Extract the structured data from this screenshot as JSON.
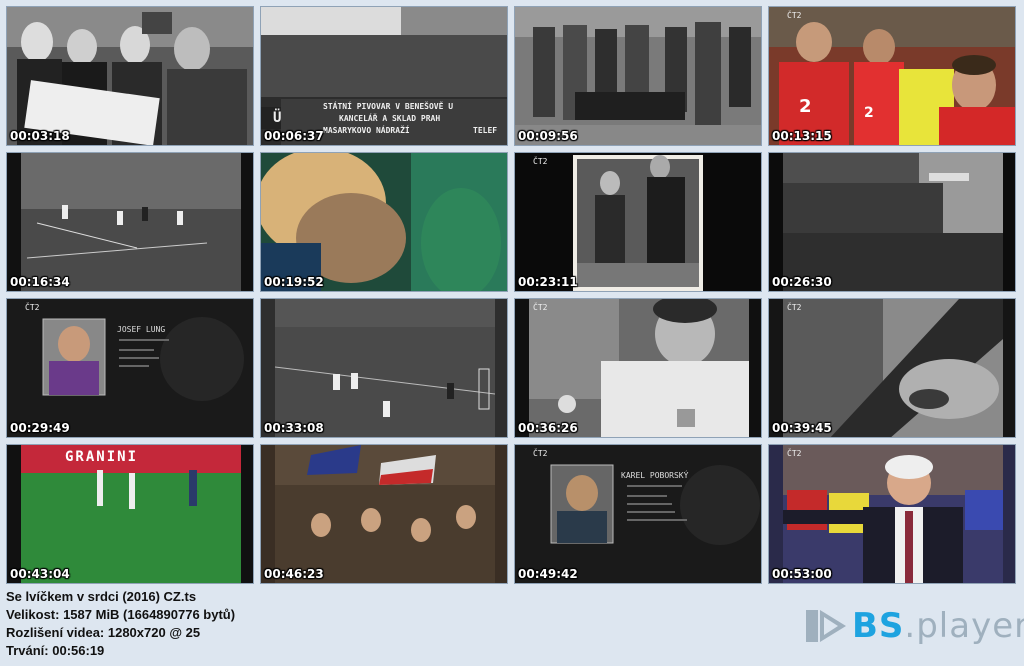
{
  "thumbnails": [
    {
      "time": "00:03:18",
      "scene": "bw-men-reading"
    },
    {
      "time": "00:06:37",
      "scene": "bw-crowd-stadium"
    },
    {
      "time": "00:09:56",
      "scene": "bw-soldiers"
    },
    {
      "time": "00:13:15",
      "scene": "color-players-red"
    },
    {
      "time": "00:16:34",
      "scene": "bw-football-match"
    },
    {
      "time": "00:19:52",
      "scene": "color-closeup-green"
    },
    {
      "time": "00:23:11",
      "scene": "bw-photo-pillarbox"
    },
    {
      "time": "00:26:30",
      "scene": "bw-crowd-square"
    },
    {
      "time": "00:29:49",
      "scene": "dark-interview-card"
    },
    {
      "time": "00:33:08",
      "scene": "bw-football-pitch"
    },
    {
      "time": "00:36:26",
      "scene": "bw-player-portrait"
    },
    {
      "time": "00:39:45",
      "scene": "bw-blurred-face"
    },
    {
      "time": "00:43:04",
      "scene": "color-green-pitch"
    },
    {
      "time": "00:46:23",
      "scene": "color-fans-flags"
    },
    {
      "time": "00:49:42",
      "scene": "dark-interview-card-2"
    },
    {
      "time": "00:53:00",
      "scene": "color-old-man-stadium"
    }
  ],
  "overlay_text": {
    "banner_line1": "STÁTNÍ PIVOVAR V BENEŠOVĚ U",
    "banner_line2": "KANCELÁŘ A SKLAD PRAH",
    "banner_line3": "MASARYKOVO NÁDRAŽÍ",
    "banner_right": "TELEF",
    "banner_mark": "Ü",
    "granini": "GRANINI",
    "interview1_name": "JOSEF LUNG",
    "interview2_name": "KAREL POBORSKÝ",
    "channel": "ČT2"
  },
  "info": {
    "filename": "Se lvíčkem v srdci (2016) CZ.ts",
    "size": "Velikost: 1587 MiB (1664890776 bytů)",
    "resolution": "Rozlišení videa: 1280x720 @ 25",
    "duration": "Trvání: 00:56:19"
  },
  "logo": {
    "bs": "BS",
    "rest": ".player"
  },
  "colors": {
    "background": "#dde6f0",
    "logo_blue": "#1ea3e0",
    "logo_gray": "#9fb0be"
  }
}
